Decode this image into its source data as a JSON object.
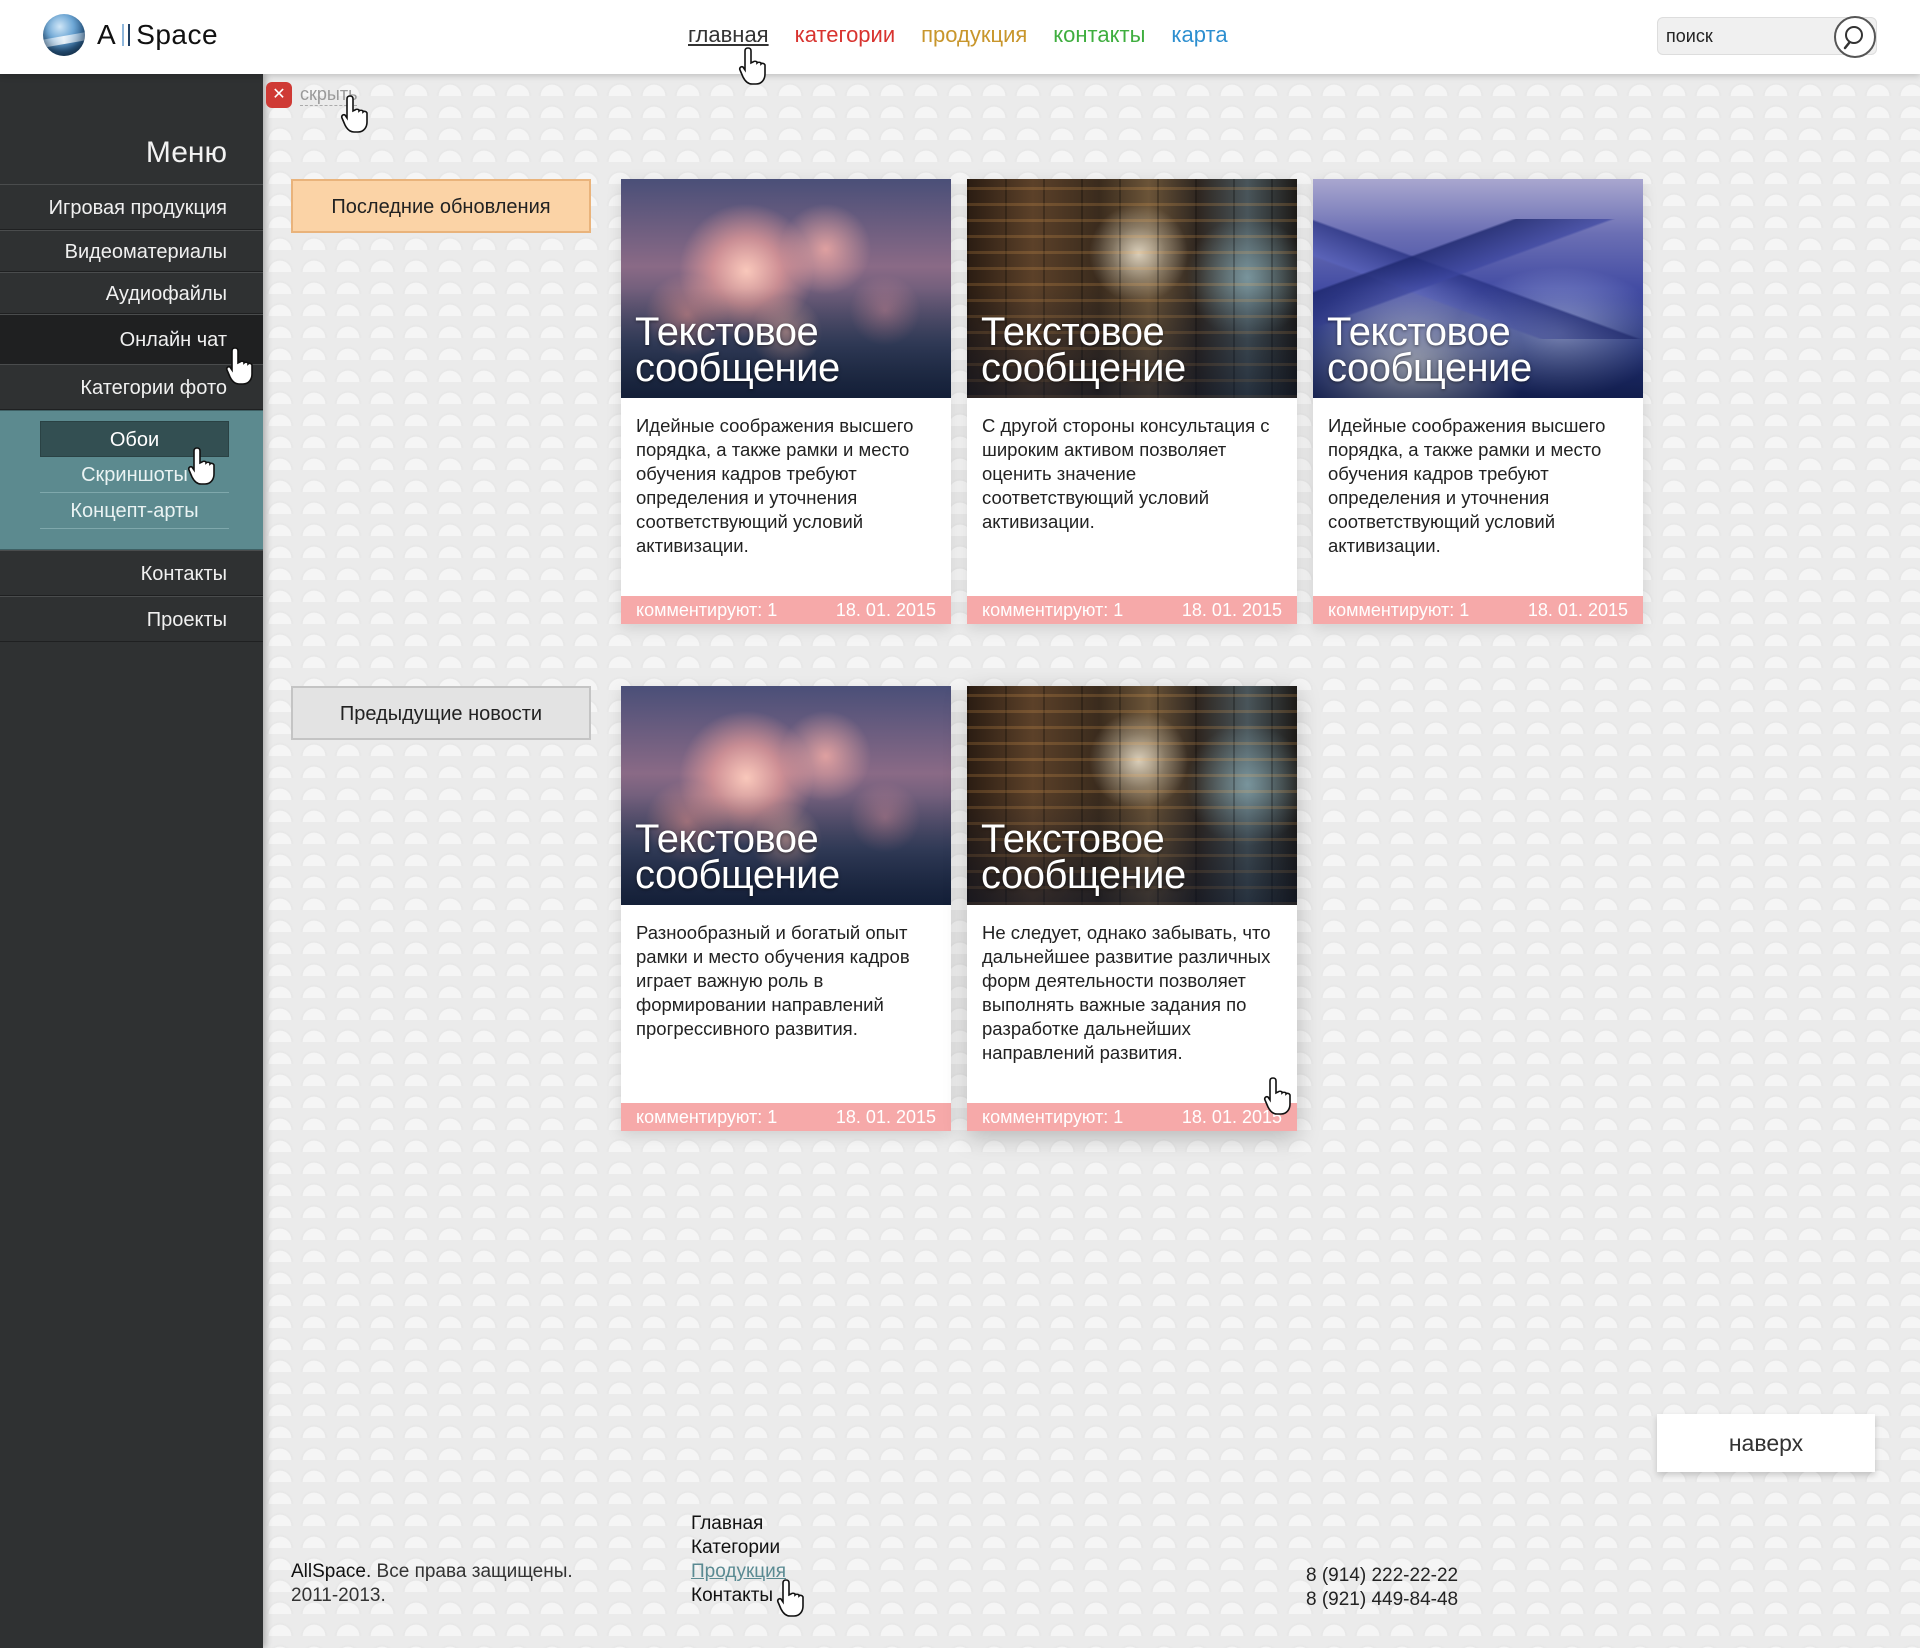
{
  "header": {
    "logo_text_a": "A",
    "logo_text_b": "Space",
    "nav": {
      "home": "главная",
      "categories": "категории",
      "products": "продукция",
      "contacts": "контакты",
      "map": "карта"
    },
    "search_placeholder": "поиск",
    "search_icon": "search-icon"
  },
  "hide": {
    "icon": "close-icon",
    "label": "скрыть"
  },
  "sidebar": {
    "title": "Меню",
    "items": [
      {
        "label": "Игровая продукция"
      },
      {
        "label": "Видеоматериалы"
      },
      {
        "label": "Аудиофайлы"
      },
      {
        "label": "Онлайн чат"
      },
      {
        "label": "Категории фото"
      }
    ],
    "subitems": [
      {
        "label": "Обои"
      },
      {
        "label": "Скриншоты"
      },
      {
        "label": "Концепт-арты"
      }
    ],
    "items_bottom": [
      {
        "label": "Контакты"
      },
      {
        "label": "Проекты"
      }
    ]
  },
  "sections": {
    "latest_label": "Последние обновления",
    "previous_label": "Предыдущие новости"
  },
  "cards": [
    {
      "title": "Текстовое сообщение",
      "text": "Идейные соображения высшего порядка, а также рамки и место обучения кадров требуют определения и уточнения соответствующий условий активизации.",
      "comments": "комментируют: 1",
      "date": "18. 01. 2015"
    },
    {
      "title": "Текстовое сообщение",
      "text": "С другой стороны консультация с широким активом позволяет оценить значение соответствующий условий активизации.",
      "comments": "комментируют: 1",
      "date": "18. 01. 2015"
    },
    {
      "title": "Текстовое сообщение",
      "text": "Идейные соображения высшего порядка, а также рамки и место обучения кадров требуют определения и уточнения соответствующий условий активизации.",
      "comments": "комментируют: 1",
      "date": "18. 01. 2015"
    },
    {
      "title": "Текстовое сообщение",
      "text": "Разнообразный и богатый опыт рамки и место обучения кадров играет важную роль в формировании направлений прогрессивного развития.",
      "comments": "комментируют: 1",
      "date": "18. 01. 2015"
    },
    {
      "title": "Текстовое сообщение",
      "text": "Не следует, однако забывать, что дальнейшее развитие различных форм деятельности позволяет выполнять важные задания по разработке дальнейших направлений развития.",
      "comments": "комментируют: 1",
      "date": "18. 01. 2015"
    }
  ],
  "to_top": "наверх",
  "footer": {
    "brand": "AllSpace.",
    "rights": " Все права защищены.",
    "years": "2011-2013.",
    "links": [
      "Главная",
      "Категории",
      "Продукция",
      "Контакты"
    ],
    "phones": [
      "8 (914) 222-22-22",
      "8 (921) 449-84-48"
    ]
  }
}
